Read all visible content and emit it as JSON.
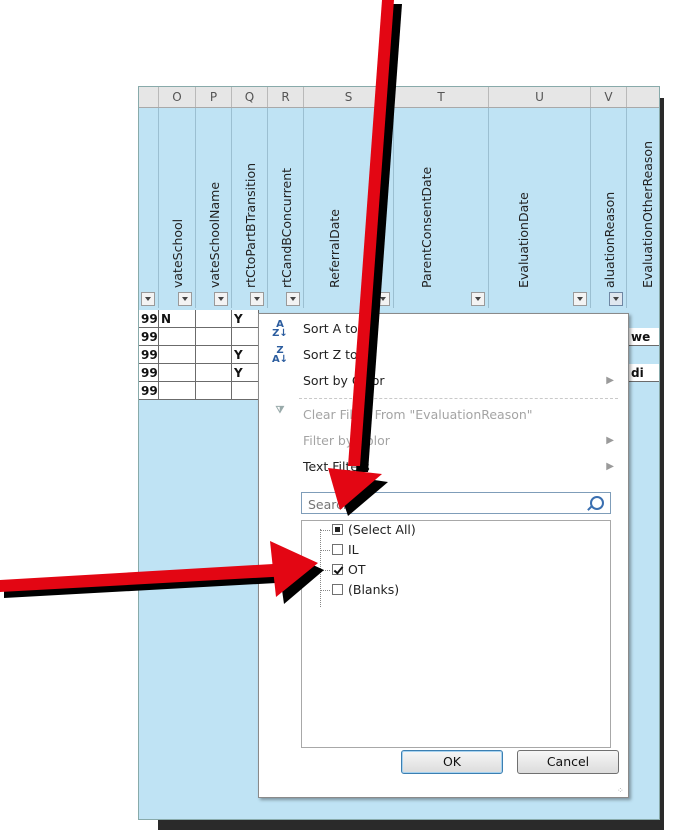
{
  "columns": [
    "O",
    "P",
    "Q",
    "R",
    "S",
    "T",
    "U",
    "V"
  ],
  "fields": [
    "vateSchool",
    "vateSchoolName",
    "rtCtoPartBTransition",
    "rtCandBConcurrent",
    "ReferralDate",
    "ParentConsentDate",
    "EvaluationDate",
    "aluationReason",
    "EvaluationOtherReason"
  ],
  "rows": [
    {
      "a": "99",
      "b": "N",
      "c": "",
      "d": "Y"
    },
    {
      "a": "99",
      "b": "",
      "c": "",
      "d": ""
    },
    {
      "a": "99",
      "b": "",
      "c": "",
      "d": "Y"
    },
    {
      "a": "99",
      "b": "",
      "c": "",
      "d": "Y"
    },
    {
      "a": "99",
      "b": "",
      "c": "",
      "d": ""
    }
  ],
  "partial_cells": [
    "we",
    "di"
  ],
  "menu": {
    "sort_az": "Sort A to Z",
    "sort_za": "Sort Z to A",
    "sort_color": "Sort by Color",
    "clear_filter": "Clear Filter From \"EvaluationReason\"",
    "filter_color": "Filter by Color",
    "text_filters": "Text Filters"
  },
  "search": {
    "placeholder": "Search"
  },
  "list": [
    {
      "label": "(Select All)",
      "state": "partial"
    },
    {
      "label": "IL",
      "state": "unchecked"
    },
    {
      "label": "OT",
      "state": "checked"
    },
    {
      "label": "(Blanks)",
      "state": "unchecked"
    }
  ],
  "buttons": {
    "ok": "OK",
    "cancel": "Cancel"
  },
  "colors": {
    "arrow": "#e30613",
    "header_bg": "#bfe3f4"
  }
}
